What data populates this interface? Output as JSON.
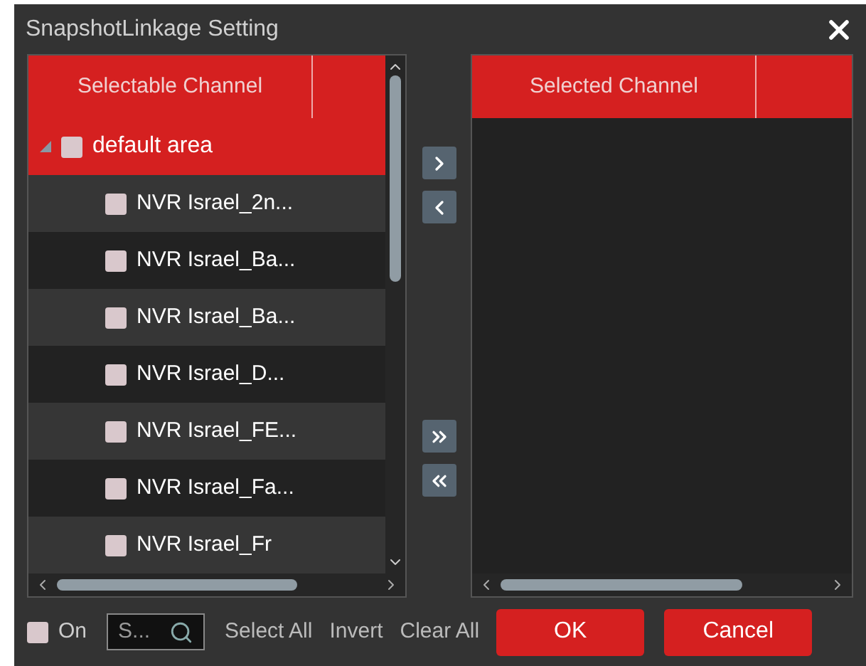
{
  "window": {
    "title": "SnapshotLinkage Setting"
  },
  "selectable": {
    "header": "Selectable Channel",
    "tree": [
      {
        "label": "default area",
        "expanded": true,
        "checked": false,
        "selected": true,
        "children": [
          {
            "label": "NVR Israel_2n...",
            "checked": false,
            "selected": false
          },
          {
            "label": "NVR Israel_Ba...",
            "checked": false,
            "selected": false
          },
          {
            "label": "NVR Israel_Ba...",
            "checked": false,
            "selected": false
          },
          {
            "label": "NVR Israel_D...",
            "checked": false,
            "selected": false
          },
          {
            "label": "NVR Israel_FE...",
            "checked": false,
            "selected": false
          },
          {
            "label": "NVR Israel_Fa...",
            "checked": false,
            "selected": false
          },
          {
            "label": "NVR Israel_Fr",
            "checked": false,
            "selected": false
          }
        ]
      }
    ]
  },
  "transfer_buttons": [
    {
      "kind": "add"
    },
    {
      "kind": "remove"
    },
    {
      "kind": "add-all"
    },
    {
      "kind": "remove-all"
    }
  ],
  "selected": {
    "header": "Selected Channel"
  },
  "footer": {
    "on": {
      "label": "On",
      "checked": false
    },
    "search": {
      "placeholder": "S..."
    },
    "links": [
      "Select All",
      "Invert",
      "Clear All"
    ],
    "buttons": [
      "OK",
      "Cancel"
    ]
  }
}
